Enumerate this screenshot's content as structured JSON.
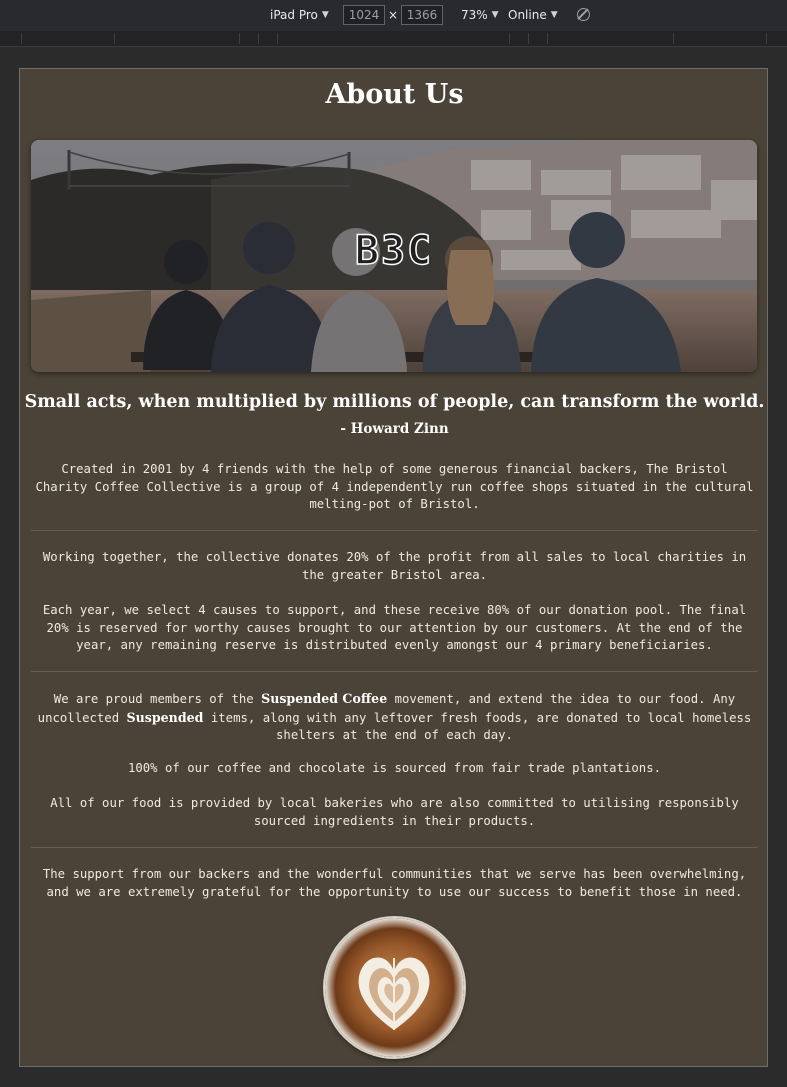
{
  "devtools": {
    "device": "iPad Pro",
    "width": "1024",
    "height": "1366",
    "times": "×",
    "zoom": "73%",
    "network": "Online"
  },
  "page": {
    "title": "About Us",
    "hero_logo": "B3C",
    "quote": "Small acts, when multiplied by millions of people, can transform the world.",
    "author": "- Howard Zinn",
    "paragraphs": [
      "Created in 2001 by 4 friends with the help of some generous financial backers, The Bristol Charity Coffee Collective is a group of 4 independently run coffee shops situated in the cultural melting-pot of Bristol.",
      "Working together, the collective donates 20% of the profit from all sales to local charities in the greater Bristol area.",
      "Each year, we select 4 causes to support, and these receive 80% of our donation pool. The final 20% is reserved for worthy causes brought to our attention by our customers. At the end of the year, any remaining reserve is distributed evenly amongst our 4 primary beneficiaries.",
      "100% of our coffee and chocolate is sourced from fair trade plantations.",
      "All of our food is provided by local bakeries who are also committed to utilising responsibly sourced ingredients in their products.",
      "The support from our backers and the wonderful communities that we serve has been overwhelming, and we are extremely grateful for the opportunity to use our success to benefit those in need."
    ],
    "suspended": {
      "part1": "We are proud members of the ",
      "bold1": "Suspended Coffee",
      "part2": " movement, and extend the idea to our food. Any uncollected ",
      "bold2": "Suspended",
      "part3": " items, along with any leftover fresh foods, are donated to local homeless shelters at the end of each day."
    }
  },
  "colors": {
    "page_background": "#4b4337",
    "text": "#efe9df",
    "devtools_bar": "#292a2d"
  }
}
